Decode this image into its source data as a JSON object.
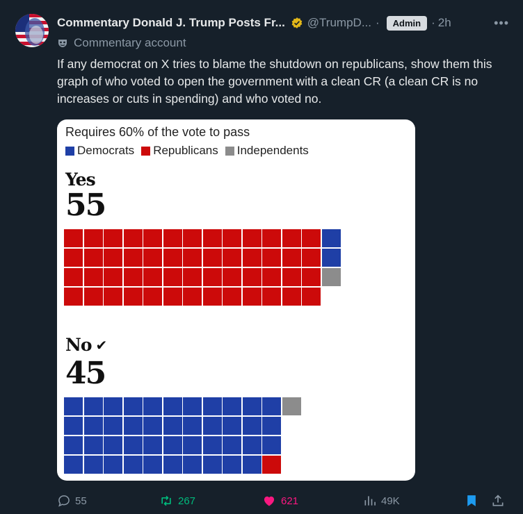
{
  "post": {
    "display_name": "Commentary Donald J. Trump Posts Fr...",
    "handle": "@TrumpD...",
    "separator": "·",
    "role_badge": "Admin",
    "time": "2h",
    "more": "•••",
    "account_label": "Commentary account",
    "body": "If any democrat on X tries to blame the shutdown on republicans, show them this graph of who voted to open the government with a clean CR (a clean CR is no increases or cuts in spending) and who voted no."
  },
  "chart_data": {
    "type": "waffle",
    "title": "Requires 60% of the vote to pass",
    "legend": [
      {
        "label": "Democrats",
        "color": "#1f3fa6"
      },
      {
        "label": "Republicans",
        "color": "#cc0a0a"
      },
      {
        "label": "Independents",
        "color": "#8c8c8c"
      }
    ],
    "groups": [
      {
        "label": "Yes",
        "mark": "",
        "total": "55",
        "Democrats": 2,
        "Republicans": 52,
        "Independents": 1
      },
      {
        "label": "No",
        "mark": "✔",
        "total": "45",
        "Democrats": 43,
        "Republicans": 1,
        "Independents": 1
      }
    ]
  },
  "stats": {
    "replies": "55",
    "reposts": "267",
    "likes": "621",
    "views": "49K"
  },
  "colors": {
    "accent": "#1d9bf0",
    "repost": "#00ba7c",
    "like": "#f91880",
    "verified": "#e2b719"
  }
}
